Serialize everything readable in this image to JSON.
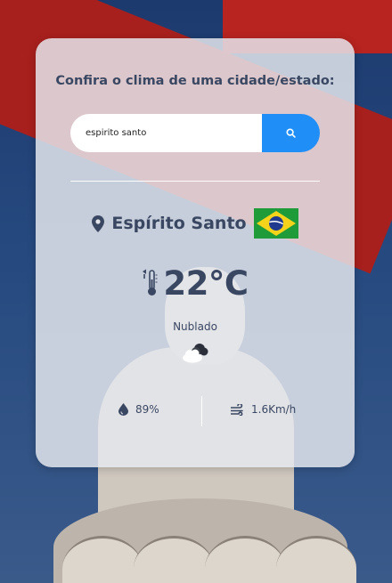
{
  "card": {
    "title": "Confira o clima de uma cidade/estado:"
  },
  "search": {
    "value": "espirito santo",
    "button_icon": "search-icon"
  },
  "location": {
    "icon": "location-pin-icon",
    "city": "Espírito Santo",
    "flag": "brazil-flag-icon"
  },
  "weather": {
    "temperature_icon": "thermometer-icon",
    "temperature": "22°C",
    "description": "Nublado",
    "condition_icon": "cloud-icon"
  },
  "details": {
    "humidity_icon": "droplet-icon",
    "humidity": "89%",
    "wind_icon": "wind-icon",
    "wind": "1.6Km/h"
  },
  "colors": {
    "accent": "#1f8ef7",
    "text": "#3a4762"
  }
}
